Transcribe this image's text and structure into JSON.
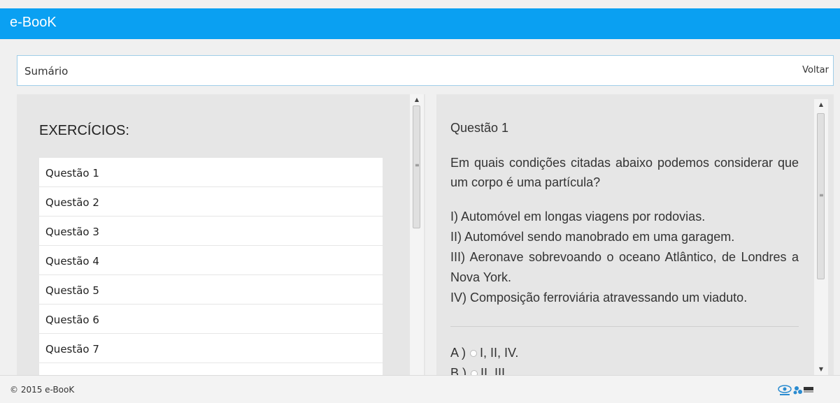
{
  "app": {
    "brand": "e-BooK",
    "brand_color": "#0aa0f2"
  },
  "header": {
    "sumario_label": "Sumário",
    "back_label": "Voltar"
  },
  "left": {
    "title": "EXERCÍCIOS:",
    "items": [
      "Questão 1",
      "Questão 2",
      "Questão 3",
      "Questão 4",
      "Questão 5",
      "Questão 6",
      "Questão 7"
    ]
  },
  "question": {
    "title": "Questão 1",
    "text": "Em quais condições citadas abaixo podemos considerar que um corpo é uma partícula?",
    "items": [
      "I) Automóvel em longas viagens por rodovias.",
      "II) Automóvel sendo manobrado em uma garagem.",
      "III) Aeronave sobrevoando o oceano Atlântico, de Londres a Nova York.",
      "IV) Composição ferroviária atravessando um viaduto."
    ],
    "options": [
      {
        "letter": "A )",
        "text": "I, II, IV."
      },
      {
        "letter": "B )",
        "text": "II, III"
      }
    ]
  },
  "footer": {
    "copyright": "© 2015 e-BooK"
  },
  "icons": {
    "scroll_up": "arrow-up-icon",
    "scroll_down": "arrow-down-icon",
    "logo": "capes-ufg-logo"
  }
}
